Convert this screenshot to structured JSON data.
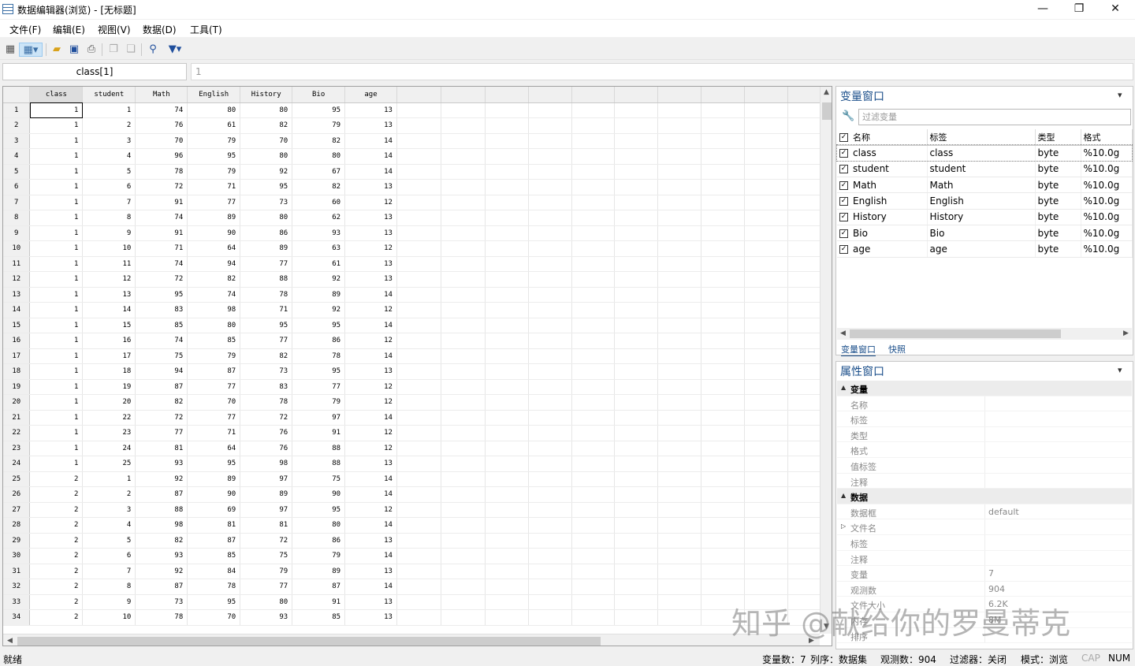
{
  "window": {
    "title": "数据编辑器(浏览) - [无标题]",
    "minimize": "—",
    "restore": "❐",
    "close": "✕"
  },
  "menu": [
    "文件(F)",
    "编辑(E)",
    "视图(V)",
    "数据(D)",
    "工具(T)"
  ],
  "namebox": "class[1]",
  "value_box": "1",
  "grid": {
    "columns": [
      "class",
      "student",
      "Math",
      "English",
      "History",
      "Bio",
      "age"
    ],
    "rows": [
      [
        1,
        1,
        1,
        74,
        80,
        80,
        95,
        13
      ],
      [
        2,
        1,
        2,
        76,
        61,
        82,
        79,
        13
      ],
      [
        3,
        1,
        3,
        70,
        79,
        70,
        82,
        14
      ],
      [
        4,
        1,
        4,
        96,
        95,
        80,
        80,
        14
      ],
      [
        5,
        1,
        5,
        78,
        79,
        92,
        67,
        14
      ],
      [
        6,
        1,
        6,
        72,
        71,
        95,
        82,
        13
      ],
      [
        7,
        1,
        7,
        91,
        77,
        73,
        60,
        12
      ],
      [
        8,
        1,
        8,
        74,
        89,
        80,
        62,
        13
      ],
      [
        9,
        1,
        9,
        91,
        90,
        86,
        93,
        13
      ],
      [
        10,
        1,
        10,
        71,
        64,
        89,
        63,
        12
      ],
      [
        11,
        1,
        11,
        74,
        94,
        77,
        61,
        13
      ],
      [
        12,
        1,
        12,
        72,
        82,
        88,
        92,
        13
      ],
      [
        13,
        1,
        13,
        95,
        74,
        78,
        89,
        14
      ],
      [
        14,
        1,
        14,
        83,
        98,
        71,
        92,
        12
      ],
      [
        15,
        1,
        15,
        85,
        80,
        95,
        95,
        14
      ],
      [
        16,
        1,
        16,
        74,
        85,
        77,
        86,
        12
      ],
      [
        17,
        1,
        17,
        75,
        79,
        82,
        78,
        14
      ],
      [
        18,
        1,
        18,
        94,
        87,
        73,
        95,
        13
      ],
      [
        19,
        1,
        19,
        87,
        77,
        83,
        77,
        12
      ],
      [
        20,
        1,
        20,
        82,
        70,
        78,
        79,
        12
      ],
      [
        21,
        1,
        22,
        72,
        77,
        72,
        97,
        14
      ],
      [
        22,
        1,
        23,
        77,
        71,
        76,
        91,
        12
      ],
      [
        23,
        1,
        24,
        81,
        64,
        76,
        88,
        12
      ],
      [
        24,
        1,
        25,
        93,
        95,
        98,
        88,
        13
      ],
      [
        25,
        2,
        1,
        92,
        89,
        97,
        75,
        14
      ],
      [
        26,
        2,
        2,
        87,
        90,
        89,
        90,
        14
      ],
      [
        27,
        2,
        3,
        88,
        69,
        97,
        95,
        12
      ],
      [
        28,
        2,
        4,
        98,
        81,
        81,
        80,
        14
      ],
      [
        29,
        2,
        5,
        82,
        87,
        72,
        86,
        13
      ],
      [
        30,
        2,
        6,
        93,
        85,
        75,
        79,
        14
      ],
      [
        31,
        2,
        7,
        92,
        84,
        79,
        89,
        13
      ],
      [
        32,
        2,
        8,
        87,
        78,
        77,
        87,
        14
      ],
      [
        33,
        2,
        9,
        73,
        95,
        80,
        91,
        13
      ],
      [
        34,
        2,
        10,
        78,
        70,
        93,
        85,
        13
      ]
    ]
  },
  "variables_panel": {
    "title": "变量窗口",
    "filter_placeholder": "过滤变量",
    "headers": [
      "名称",
      "标签",
      "类型",
      "格式"
    ],
    "rows": [
      [
        "class",
        "class",
        "byte",
        "%10.0g"
      ],
      [
        "student",
        "student",
        "byte",
        "%10.0g"
      ],
      [
        "Math",
        "Math",
        "byte",
        "%10.0g"
      ],
      [
        "English",
        "English",
        "byte",
        "%10.0g"
      ],
      [
        "History",
        "History",
        "byte",
        "%10.0g"
      ],
      [
        "Bio",
        "Bio",
        "byte",
        "%10.0g"
      ],
      [
        "age",
        "age",
        "byte",
        "%10.0g"
      ]
    ],
    "tabs": [
      "变量窗口",
      "快照"
    ]
  },
  "properties_panel": {
    "title": "属性窗口",
    "groups": [
      {
        "name": "变量",
        "items": [
          [
            "名称",
            ""
          ],
          [
            "标签",
            ""
          ],
          [
            "类型",
            ""
          ],
          [
            "格式",
            ""
          ],
          [
            "值标签",
            ""
          ],
          [
            "注释",
            ""
          ]
        ]
      },
      {
        "name": "数据",
        "items": [
          [
            "数据框",
            "default"
          ],
          [
            "文件名",
            ""
          ],
          [
            "标签",
            ""
          ],
          [
            "注释",
            ""
          ],
          [
            "变量",
            "7"
          ],
          [
            "观测数",
            "904"
          ],
          [
            "文件大小",
            "6.2K"
          ],
          [
            "内存",
            "8M"
          ],
          [
            "排序",
            ""
          ]
        ]
      }
    ]
  },
  "status": {
    "left": "就绪",
    "vars": "变量数：7",
    "order": "列序：数据集",
    "obs": "观测数：904",
    "filter": "过滤器：关闭",
    "mode": "模式：浏览",
    "cap": "CAP",
    "num": "NUM"
  },
  "watermark": "知乎 @献给你的罗曼蒂克"
}
